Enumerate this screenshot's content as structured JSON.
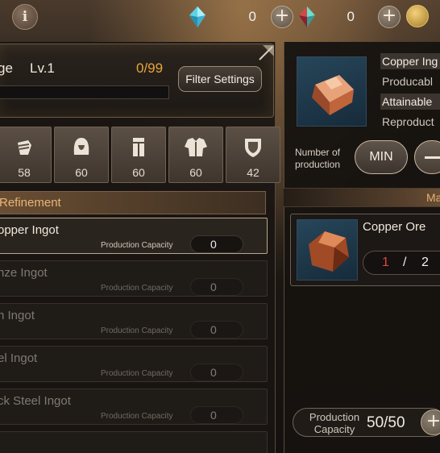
{
  "topbar": {
    "info_label": "i",
    "currency_1": {
      "icon": "blue-crystal-icon",
      "count": "0",
      "plus": "+"
    },
    "currency_2": {
      "icon": "red-crystal-icon",
      "count": "0",
      "plus": "+"
    },
    "currency_3": {
      "icon": "gold-coin-icon"
    }
  },
  "header": {
    "name": "ge",
    "level": "Lv.1",
    "count": "0/99",
    "progress_fraction": 0,
    "filter_label": "Filter Settings"
  },
  "categories": [
    {
      "icon": "glove-icon",
      "count": "58"
    },
    {
      "icon": "hood-icon",
      "count": "60"
    },
    {
      "icon": "leg-armor-icon",
      "count": "60"
    },
    {
      "icon": "chest-armor-icon",
      "count": "60"
    },
    {
      "icon": "shield-icon",
      "count": "42"
    }
  ],
  "section_title": "Refinement",
  "recipes": [
    {
      "name": "opper Ingot",
      "cap_label": "Production Capacity",
      "cap": "0",
      "selected": true
    },
    {
      "name": "nze Ingot",
      "cap_label": "Production Capacity",
      "cap": "0",
      "selected": false
    },
    {
      "name": "n Ingot",
      "cap_label": "Production Capacity",
      "cap": "0",
      "selected": false
    },
    {
      "name": "el Ingot",
      "cap_label": "Production Capacity",
      "cap": "0",
      "selected": false
    },
    {
      "name": "ck Steel Ingot",
      "cap_label": "Production Capacity",
      "cap": "0",
      "selected": false
    }
  ],
  "detail": {
    "item_name": "Copper Ing",
    "producible": "Producabl",
    "attainable": "Attainable",
    "reproduction": "Reproduct",
    "nop_label": "Number of production",
    "min_label": "MIN",
    "materials_header": "Ma",
    "material": {
      "name": "Copper Ore",
      "have": "1",
      "sep": "/",
      "need": "2"
    },
    "pc_label": "Production Capacity",
    "pc_value": "50/50",
    "pc_plus": "+"
  }
}
